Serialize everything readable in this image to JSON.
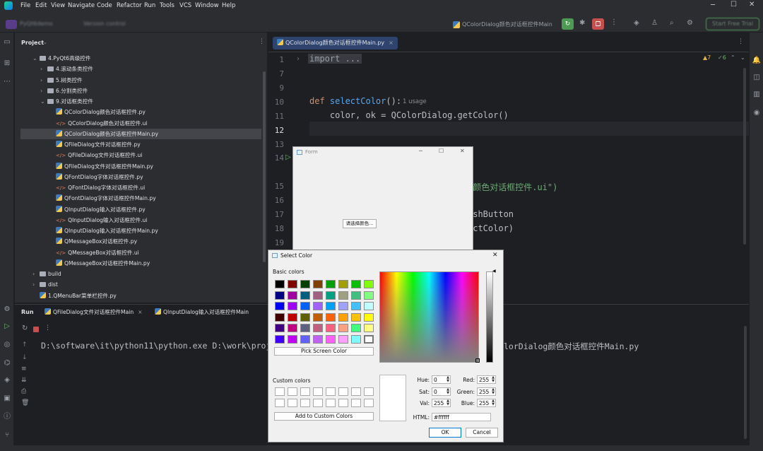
{
  "menu": [
    "File",
    "Edit",
    "View",
    "Navigate",
    "Code",
    "Refactor",
    "Run",
    "Tools",
    "VCS",
    "Window",
    "Help"
  ],
  "titlebar": {
    "project_name": "PyQt6demo",
    "branch": "Version control",
    "run_config": "QColorDialog颜色对话框控件Main",
    "start_trial": "Start Free Trial"
  },
  "project": {
    "header": "Project",
    "items": [
      {
        "label": "4.PyQt6高级控件",
        "kind": "folder",
        "level": 1,
        "open": true
      },
      {
        "label": "4.滚动条类控件",
        "kind": "folder",
        "level": 2
      },
      {
        "label": "5.树类控件",
        "kind": "folder",
        "level": 2
      },
      {
        "label": "6.分割类控件",
        "kind": "folder",
        "level": 2
      },
      {
        "label": "9.对话框类控件",
        "kind": "folder",
        "level": 2,
        "open": true
      },
      {
        "label": "QColorDialog颜色对话框控件.py",
        "kind": "py",
        "level": 3
      },
      {
        "label": "QColorDialog颜色对话框控件.ui",
        "kind": "ui",
        "level": 3
      },
      {
        "label": "QColorDialog颜色对话框控件Main.py",
        "kind": "py",
        "level": 3,
        "selected": true
      },
      {
        "label": "QFileDialog文件对话框控件.py",
        "kind": "py",
        "level": 3
      },
      {
        "label": "QFileDialog文件对话框控件.ui",
        "kind": "ui",
        "level": 3
      },
      {
        "label": "QFileDialog文件对话框控件Main.py",
        "kind": "py",
        "level": 3
      },
      {
        "label": "QFontDialog字体对话框控件.py",
        "kind": "py",
        "level": 3
      },
      {
        "label": "QFontDialog字体对话框控件.ui",
        "kind": "ui",
        "level": 3
      },
      {
        "label": "QFontDialog字体对话框控件Main.py",
        "kind": "py",
        "level": 3
      },
      {
        "label": "QInputDialog输入对话框控件.py",
        "kind": "py",
        "level": 3
      },
      {
        "label": "QInputDialog输入对话框控件.ui",
        "kind": "ui",
        "level": 3
      },
      {
        "label": "QInputDialog输入对话框控件Main.py",
        "kind": "py",
        "level": 3
      },
      {
        "label": "QMessageBox对话框控件.py",
        "kind": "py",
        "level": 3
      },
      {
        "label": "QMessageBox对话框控件.ui",
        "kind": "ui",
        "level": 3
      },
      {
        "label": "QMessageBox对话框控件Main.py",
        "kind": "py",
        "level": 3
      },
      {
        "label": "build",
        "kind": "folder",
        "level": 1
      },
      {
        "label": "dist",
        "kind": "folder",
        "level": 1
      },
      {
        "label": "1.QMenuBar菜单栏控件.py",
        "kind": "py",
        "level": 1
      }
    ]
  },
  "editor": {
    "tab": "QColorDialog颜色对话框控件Main.py",
    "warnings": "▲7",
    "checks": "✓6",
    "lines": [
      {
        "n": "1",
        "t": "import ..."
      },
      {
        "n": "7",
        "t": ""
      },
      {
        "n": "9",
        "t": ""
      },
      {
        "n": "10",
        "t": "def selectColor():"
      },
      {
        "n": "11",
        "t": "    color, ok = QColorDialog.getColor()"
      },
      {
        "n": "12",
        "t": ""
      },
      {
        "n": "13",
        "t": ""
      },
      {
        "n": "14",
        "t": ""
      },
      {
        "n": "15",
        "t": "g颜色对话框控件.ui\")"
      },
      {
        "n": "16",
        "t": ""
      },
      {
        "n": "17",
        "t": "ushButton"
      },
      {
        "n": "18",
        "t": "ectColor)"
      },
      {
        "n": "19",
        "t": ""
      }
    ],
    "usage": "1 usage"
  },
  "run": {
    "label": "Run",
    "tabs": [
      "QFileDialog文件对话框控件Main",
      "QInputDialog输入对话框控件Main"
    ],
    "output_left": "D:\\software\\it\\python11\\python.exe D:\\work\\proj",
    "output_right": "lorDialog颜色对话框控件Main.py"
  },
  "form": {
    "title": "Form",
    "button": "请选择颜色..."
  },
  "color_dialog": {
    "title": "Select Color",
    "basic_colors_label": "Basic colors",
    "basic_colors": [
      [
        "#000000",
        "#800000",
        "#004000",
        "#804000",
        "#00a000",
        "#a0a000",
        "#00c000",
        "#80ff00"
      ],
      [
        "#000080",
        "#a000a0",
        "#006080",
        "#a06080",
        "#00a080",
        "#a0a080",
        "#40c080",
        "#80ff80"
      ],
      [
        "#0000ff",
        "#a000ff",
        "#0060ff",
        "#a060ff",
        "#00a0ff",
        "#a0a0ff",
        "#40c0ff",
        "#c0ffff"
      ],
      [
        "#400000",
        "#c00000",
        "#606000",
        "#c06000",
        "#ff6000",
        "#ffa000",
        "#ffc000",
        "#ffff00"
      ],
      [
        "#400080",
        "#c00080",
        "#606080",
        "#c06080",
        "#ff6080",
        "#ffa080",
        "#40ff80",
        "#ffff80"
      ],
      [
        "#4000ff",
        "#c000ff",
        "#6060ff",
        "#c060ff",
        "#ff60ff",
        "#ffa0ff",
        "#80ffff",
        "#ffffff"
      ]
    ],
    "pick_screen": "Pick Screen Color",
    "custom_colors_label": "Custom colors",
    "add_custom": "Add to Custom Colors",
    "hue_label": "Hue:",
    "hue": "0",
    "sat_label": "Sat:",
    "sat": "0",
    "val_label": "Val:",
    "val": "255",
    "red_label": "Red:",
    "red": "255",
    "green_label": "Green:",
    "green": "255",
    "blue_label": "Blue:",
    "blue": "255",
    "html_label": "HTML:",
    "html": "#ffffff",
    "ok": "OK",
    "cancel": "Cancel"
  }
}
